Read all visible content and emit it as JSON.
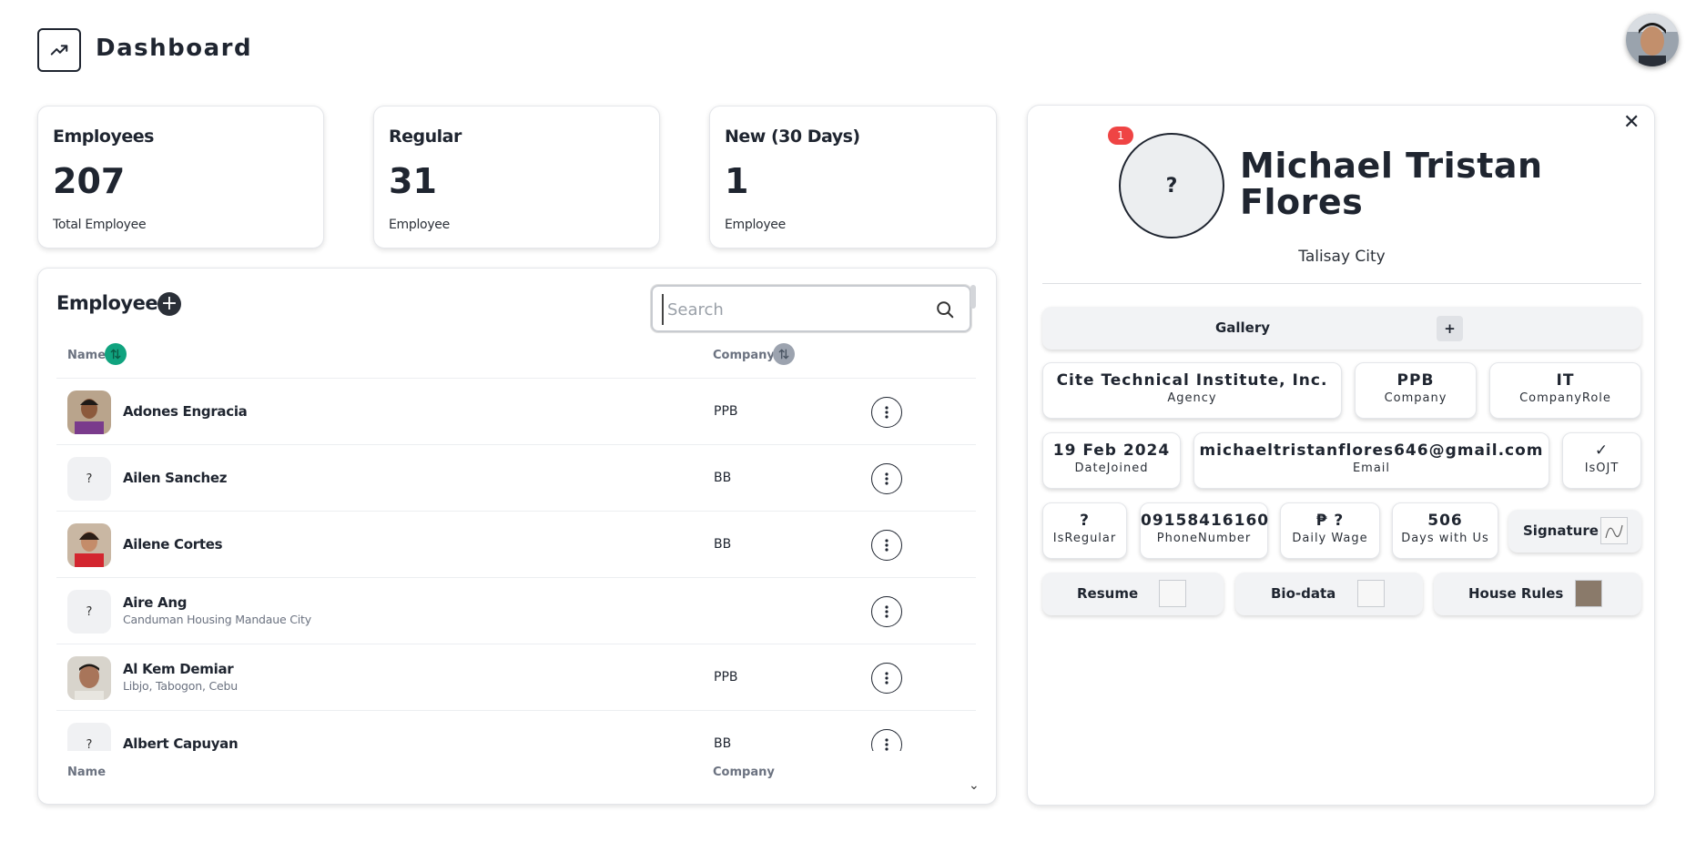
{
  "header": {
    "title": "Dashboard",
    "logo_icon": "trending-up-icon"
  },
  "stats": [
    {
      "label": "Employees",
      "value": "207",
      "sub": "Total Employee"
    },
    {
      "label": "Regular",
      "value": "31",
      "sub": "Employee"
    },
    {
      "label": "New (30 Days)",
      "value": "1",
      "sub": "Employee"
    }
  ],
  "employees": {
    "title": "Employees",
    "search_placeholder": "Search",
    "col_name": "Name",
    "col_company": "Company",
    "rows": [
      {
        "name": "Adones Engracia",
        "address": "",
        "company": "PPB",
        "avatar": "photo"
      },
      {
        "name": "Ailen Sanchez",
        "address": "",
        "company": "BB",
        "avatar": "?"
      },
      {
        "name": "Ailene Cortes",
        "address": "",
        "company": "BB",
        "avatar": "photo"
      },
      {
        "name": "Aire Ang",
        "address": "Canduman Housing Mandaue City",
        "company": "",
        "avatar": "?"
      },
      {
        "name": "Al Kem Demiar",
        "address": "Libjo, Tabogon, Cebu",
        "company": "PPB",
        "avatar": "photo"
      },
      {
        "name": "Albert Capuyan",
        "address": "",
        "company": "BB",
        "avatar": "?"
      }
    ]
  },
  "profile": {
    "badge": "1",
    "avatar_placeholder": "?",
    "name": "Michael Tristan Flores",
    "city": "Talisay City",
    "gallery_label": "Gallery",
    "gallery_add": "+",
    "agency": {
      "value": "Cite Technical Institute, Inc.",
      "key": "Agency"
    },
    "company": {
      "value": "PPB",
      "key": "Company"
    },
    "company_role": {
      "value": "IT",
      "key": "CompanyRole"
    },
    "date_joined": {
      "value": "19 Feb 2024",
      "key": "DateJoined"
    },
    "email": {
      "value": "michaeltristanflores646@gmail.com",
      "key": "Email"
    },
    "is_ojt": {
      "value": "✓",
      "key": "IsOJT"
    },
    "is_regular": {
      "value": "?",
      "key": "IsRegular"
    },
    "phone": {
      "value": "09158416160",
      "key": "PhoneNumber"
    },
    "daily_wage": {
      "value": "₱ ?",
      "key": "Daily Wage"
    },
    "days_with_us": {
      "value": "506",
      "key": "Days with Us"
    },
    "signature_label": "Signature",
    "resume_label": "Resume",
    "biodata_label": "Bio-data",
    "house_rules_label": "House Rules"
  }
}
